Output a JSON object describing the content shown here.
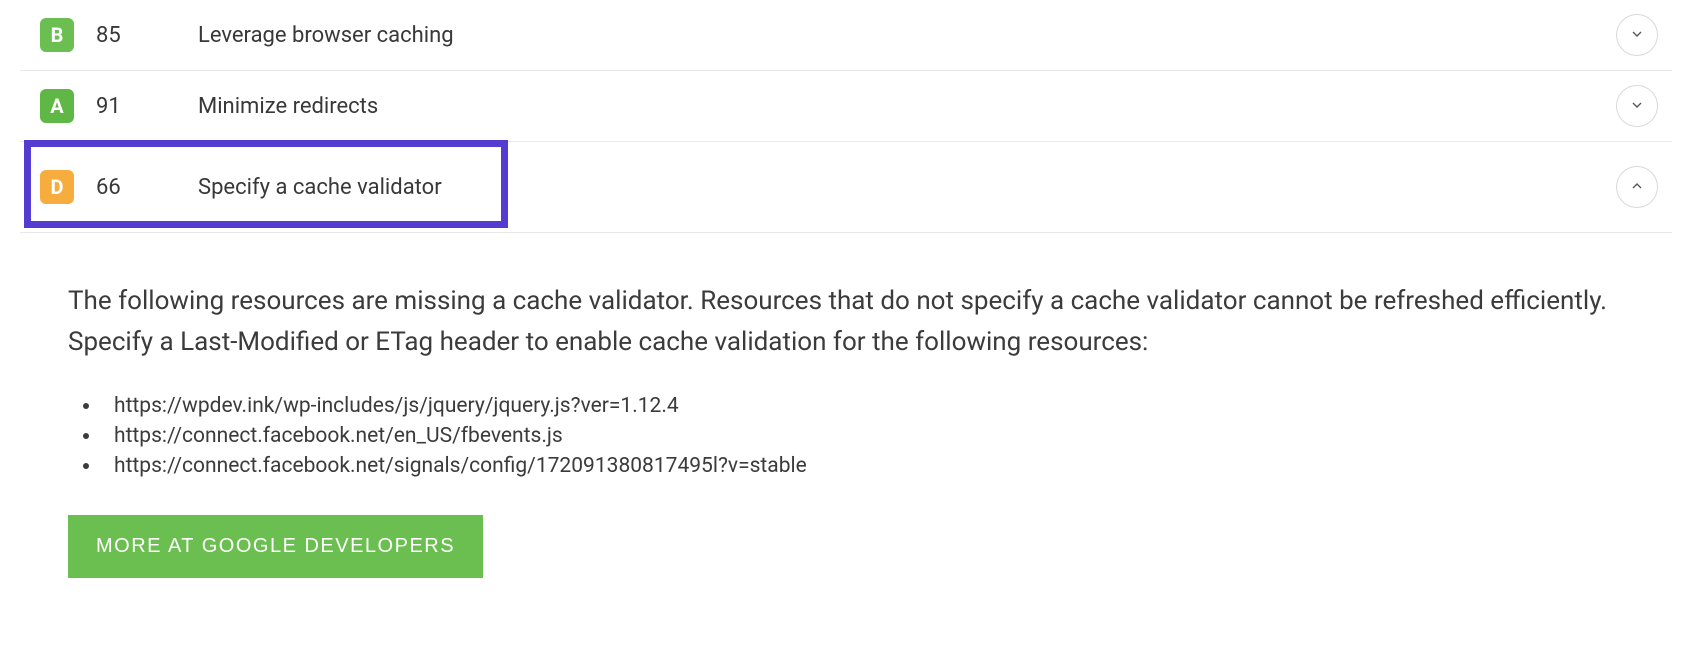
{
  "rules": [
    {
      "grade": "B",
      "score": "85",
      "name": "Leverage browser caching",
      "expanded": false
    },
    {
      "grade": "A",
      "score": "91",
      "name": "Minimize redirects",
      "expanded": false
    },
    {
      "grade": "D",
      "score": "66",
      "name": "Specify a cache validator",
      "expanded": true,
      "highlighted": true
    }
  ],
  "details": {
    "description": "The following resources are missing a cache validator. Resources that do not specify a cache validator cannot be refreshed efficiently. Specify a Last-Modified or ETag header to enable cache validation for the following resources:",
    "resources": [
      "https://wpdev.ink/wp-includes/js/jquery/jquery.js?ver=1.12.4",
      "https://connect.facebook.net/en_US/fbevents.js",
      "https://connect.facebook.net/signals/config/172091380817495l?v=stable"
    ],
    "more_button": "MORE AT GOOGLE DEVELOPERS"
  },
  "colors": {
    "grade_A": "#5fb745",
    "grade_B": "#6bbf50",
    "grade_D": "#f6ad3d",
    "highlight": "#553cd1",
    "button": "#6bbf50"
  }
}
